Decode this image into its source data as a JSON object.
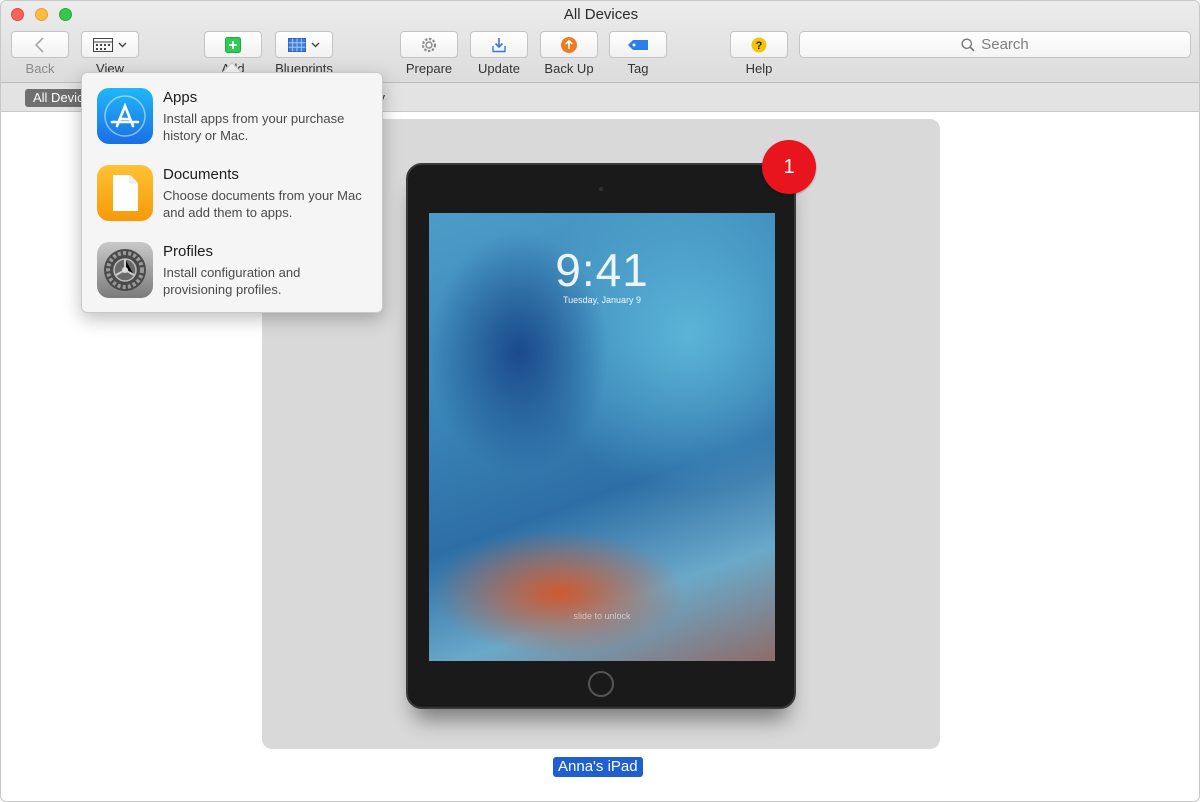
{
  "window": {
    "title": "All Devices"
  },
  "toolbar": {
    "back_label": "Back",
    "view_label": "View",
    "add_label": "Add",
    "blueprints_label": "Blueprints",
    "prepare_label": "Prepare",
    "update_label": "Update",
    "backup_label": "Back Up",
    "tag_label": "Tag",
    "help_label": "Help",
    "search_placeholder": "Search"
  },
  "scope": {
    "selected": "All Devices",
    "other": "ery"
  },
  "add_menu": {
    "items": [
      {
        "title": "Apps",
        "description": "Install apps from your purchase history or Mac.",
        "icon": "app-store-icon"
      },
      {
        "title": "Documents",
        "description": "Choose documents from your Mac and add them to apps.",
        "icon": "document-icon"
      },
      {
        "title": "Profiles",
        "description": "Install configuration and provisioning profiles.",
        "icon": "settings-gear-icon"
      }
    ]
  },
  "device": {
    "name": "Anna's iPad",
    "badge_count": "1",
    "lock_time": "9:41",
    "lock_date": "Tuesday, January 9",
    "lock_hint": "slide to unlock"
  },
  "colors": {
    "badge": "#e8141e",
    "selection": "#1f5fd0",
    "add_green": "#2ecc55",
    "update_blue": "#3a78d8",
    "backup_orange": "#f07a20",
    "tag_blue": "#2d7ee8",
    "help_yellow": "#f5c400"
  }
}
